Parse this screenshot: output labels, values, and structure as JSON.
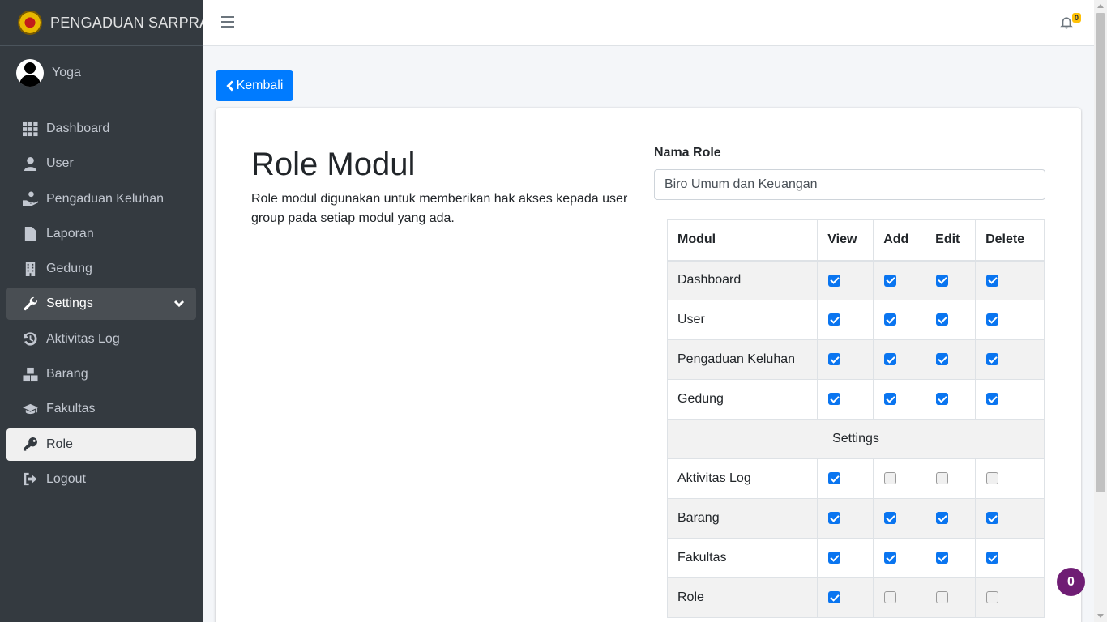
{
  "brand": {
    "title": "PENGADUAN SARPRAS"
  },
  "user": {
    "name": "Yoga"
  },
  "sidebar": {
    "items": [
      {
        "label": "Dashboard",
        "icon": "th-icon"
      },
      {
        "label": "User",
        "icon": "user-icon"
      },
      {
        "label": "Pengaduan Keluhan",
        "icon": "hand-icon"
      },
      {
        "label": "Laporan",
        "icon": "file-icon"
      },
      {
        "label": "Gedung",
        "icon": "building-icon"
      },
      {
        "label": "Settings",
        "icon": "wrench-icon"
      },
      {
        "label": "Aktivitas Log",
        "icon": "history-icon"
      },
      {
        "label": "Barang",
        "icon": "boxes-icon"
      },
      {
        "label": "Fakultas",
        "icon": "graduation-cap-icon"
      },
      {
        "label": "Role",
        "icon": "key-icon"
      },
      {
        "label": "Logout",
        "icon": "sign-out-icon"
      }
    ]
  },
  "header": {
    "notification_count": "0"
  },
  "back_button": {
    "label": "Kembali"
  },
  "page": {
    "title": "Role Modul",
    "description": "Role modul digunakan untuk memberikan hak akses kepada user group pada setiap modul yang ada."
  },
  "form": {
    "role_label": "Nama Role",
    "role_value": "Biro Umum dan Keuangan"
  },
  "table": {
    "headers": {
      "modul": "Modul",
      "view": "View",
      "add": "Add",
      "edit": "Edit",
      "delete": "Delete"
    },
    "rows": [
      {
        "modul": "Dashboard",
        "view": true,
        "add": true,
        "edit": true,
        "delete": true
      },
      {
        "modul": "User",
        "view": true,
        "add": true,
        "edit": true,
        "delete": true
      },
      {
        "modul": "Pengaduan Keluhan",
        "view": true,
        "add": true,
        "edit": true,
        "delete": true
      },
      {
        "modul": "Gedung",
        "view": true,
        "add": true,
        "edit": true,
        "delete": true
      }
    ],
    "group_label": "Settings",
    "settings_rows": [
      {
        "modul": "Aktivitas Log",
        "view": true,
        "add": false,
        "edit": false,
        "delete": false
      },
      {
        "modul": "Barang",
        "view": true,
        "add": true,
        "edit": true,
        "delete": true
      },
      {
        "modul": "Fakultas",
        "view": true,
        "add": true,
        "edit": true,
        "delete": true
      },
      {
        "modul": "Role",
        "view": true,
        "add": false,
        "edit": false,
        "delete": false
      }
    ]
  },
  "chat": {
    "count": "0"
  },
  "colors": {
    "sidebar": "#343a40",
    "primary": "#007bff",
    "checkbox": "#0a75f0",
    "chat": "#6f1d74",
    "badge": "#ffc107"
  }
}
